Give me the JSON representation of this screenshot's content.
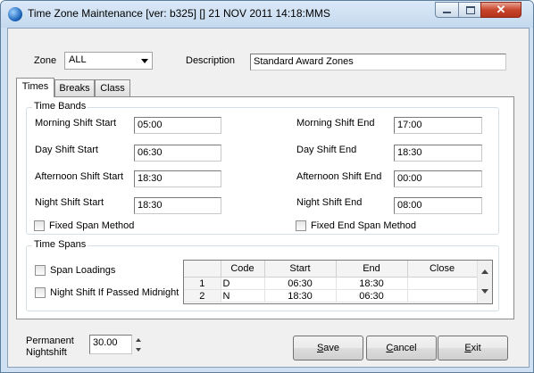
{
  "window": {
    "title": "Time Zone Maintenance [ver: b325] [] 21 NOV 2011 14:18:MMS",
    "controls": [
      "minimize",
      "maximize",
      "close"
    ],
    "close_glyph": "✕"
  },
  "header": {
    "zone_label": "Zone",
    "zone_value": "ALL",
    "description_label": "Description",
    "description_value": "Standard Award Zones"
  },
  "tabs": [
    {
      "label": "Times",
      "active": true
    },
    {
      "label": "Breaks",
      "active": false
    },
    {
      "label": "Class",
      "active": false
    }
  ],
  "time_bands": {
    "title": "Time Bands",
    "morning_start_label": "Morning Shift Start",
    "morning_start_value": "05:00",
    "day_start_label": "Day Shift Start",
    "day_start_value": "06:30",
    "afternoon_start_label": "Afternoon Shift Start",
    "afternoon_start_value": "18:30",
    "night_start_label": "Night Shift Start",
    "night_start_value": "18:30",
    "morning_end_label": "Morning Shift End",
    "morning_end_value": "17:00",
    "day_end_label": "Day Shift End",
    "day_end_value": "18:30",
    "afternoon_end_label": "Afternoon Shift End",
    "afternoon_end_value": "00:00",
    "night_end_label": "Night Shift End",
    "night_end_value": "08:00",
    "fixed_span_label": "Fixed Span Method",
    "fixed_end_span_label": "Fixed End Span Method"
  },
  "time_spans": {
    "title": "Time Spans",
    "span_loadings_label": "Span Loadings",
    "night_shift_label": "Night Shift If Passed Midnight",
    "columns": [
      "Code",
      "Start",
      "End",
      "Close"
    ],
    "rows": [
      {
        "num": "1",
        "code": "D",
        "start": "06:30",
        "end": "18:30",
        "close": ""
      },
      {
        "num": "2",
        "code": "N",
        "start": "18:30",
        "end": "06:30",
        "close": ""
      }
    ]
  },
  "footer": {
    "permanent_label_line1": "Permanent",
    "permanent_label_line2": "Nightshift",
    "permanent_value": "30.00",
    "save_label_prefix": "",
    "save_mnemonic": "S",
    "save_label_rest": "ave",
    "cancel_label_prefix": "",
    "cancel_mnemonic": "C",
    "cancel_label_rest": "ancel",
    "exit_label_prefix": "",
    "exit_mnemonic": "E",
    "exit_label_rest": "xit"
  }
}
